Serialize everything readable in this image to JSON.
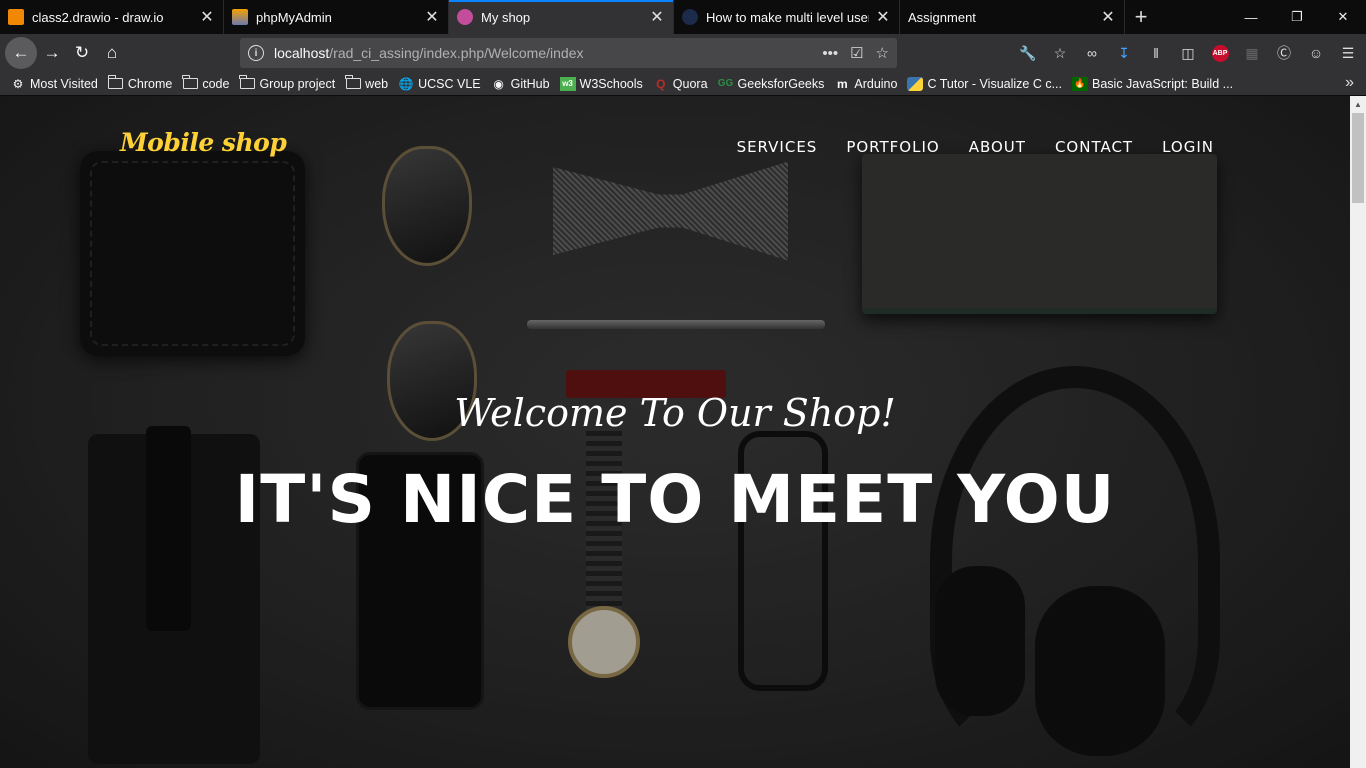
{
  "tabs": [
    {
      "title": "class2.drawio - draw.io",
      "favicon_color": "#f08705",
      "active": false
    },
    {
      "title": "phpMyAdmin",
      "favicon_color": "#f4a000",
      "active": false
    },
    {
      "title": "My shop",
      "favicon_color": "#c34d9b",
      "active": true
    },
    {
      "title": "How to make multi level user lo",
      "favicon_color": "#1c2b4a",
      "active": false
    },
    {
      "title": "Assignment",
      "favicon_color": "",
      "active": false
    }
  ],
  "address": {
    "host": "localhost",
    "path": "/rad_ci_assing/index.php/Welcome/index"
  },
  "bookmarks": [
    {
      "label": "Most Visited",
      "icon": "gear-icon"
    },
    {
      "label": "Chrome",
      "icon": "folder-icon"
    },
    {
      "label": "code",
      "icon": "folder-icon"
    },
    {
      "label": "Group project",
      "icon": "folder-icon"
    },
    {
      "label": "web",
      "icon": "folder-icon"
    },
    {
      "label": "UCSC VLE",
      "icon": "globe-icon"
    },
    {
      "label": "GitHub",
      "icon": "github-icon"
    },
    {
      "label": "W3Schools",
      "icon": "w3schools-icon"
    },
    {
      "label": "Quora",
      "icon": "quora-icon"
    },
    {
      "label": "GeeksforGeeks",
      "icon": "gfg-icon"
    },
    {
      "label": "Arduino",
      "icon": "arduino-icon"
    },
    {
      "label": "C Tutor - Visualize C c...",
      "icon": "python-icon"
    },
    {
      "label": "Basic JavaScript: Build ...",
      "icon": "fcc-icon"
    }
  ],
  "site": {
    "brand": "Mobile shop",
    "nav": [
      "SERVICES",
      "PORTFOLIO",
      "ABOUT",
      "CONTACT",
      "LOGIN"
    ],
    "subheading": "Welcome To Our Shop!",
    "heading": "IT'S NICE TO MEET YOU",
    "accent_color": "#fed136"
  },
  "colors": {
    "active_tab_indicator": "#0a84ff",
    "toolbar": "#323234"
  }
}
